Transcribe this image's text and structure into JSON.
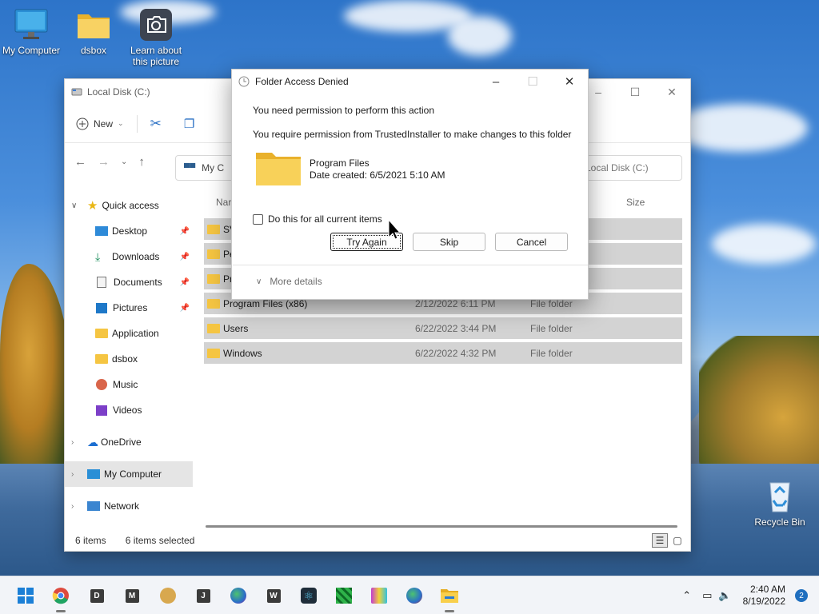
{
  "desktop": {
    "icons": [
      {
        "label": "My Computer"
      },
      {
        "label": "dsbox"
      },
      {
        "label": "Learn about this picture"
      },
      {
        "label": "Recycle Bin"
      }
    ]
  },
  "explorer": {
    "title": "Local Disk (C:)",
    "command_bar": {
      "new_label": "New"
    },
    "address": {
      "path_visible": "My C",
      "search_placeholder": "Local Disk (C:)"
    },
    "nav": {
      "quick_access": "Quick access",
      "items": [
        {
          "label": "Desktop",
          "pinned": true
        },
        {
          "label": "Downloads",
          "pinned": true
        },
        {
          "label": "Documents",
          "pinned": true
        },
        {
          "label": "Pictures",
          "pinned": true
        },
        {
          "label": "Application",
          "pinned": false
        },
        {
          "label": "dsbox",
          "pinned": false
        },
        {
          "label": "Music",
          "pinned": false
        },
        {
          "label": "Videos",
          "pinned": false
        }
      ],
      "onedrive": "OneDrive",
      "my_computer": "My Computer",
      "network": "Network"
    },
    "columns": {
      "name": "Nar",
      "size": "Size"
    },
    "files": [
      {
        "name": "SV",
        "date": "",
        "type": ""
      },
      {
        "name": "Pe",
        "date": "",
        "type": ""
      },
      {
        "name": "Pr",
        "date": "",
        "type": ""
      },
      {
        "name": "Program Files (x86)",
        "date": "2/12/2022 6:11 PM",
        "type": "File folder"
      },
      {
        "name": "Users",
        "date": "6/22/2022 3:44 PM",
        "type": "File folder"
      },
      {
        "name": "Windows",
        "date": "6/22/2022 4:32 PM",
        "type": "File folder"
      }
    ],
    "status": {
      "items": "6 items",
      "selected": "6 items selected"
    }
  },
  "dialog": {
    "title": "Folder Access Denied",
    "message1": "You need permission to perform this action",
    "message2": "You require permission from TrustedInstaller to make changes to this folder",
    "folder_name": "Program Files",
    "folder_date": "Date created: 6/5/2021 5:10 AM",
    "checkbox_label": "Do this for all current items",
    "checkbox_checked": false,
    "buttons": {
      "try_again": "Try Again",
      "skip": "Skip",
      "cancel": "Cancel"
    },
    "more_details": "More details"
  },
  "taskbar": {
    "apps": [
      {
        "icon": "windows-start-icon"
      },
      {
        "icon": "chrome-icon"
      },
      {
        "letter": "D"
      },
      {
        "letter": "M"
      },
      {
        "icon": "doge-icon"
      },
      {
        "letter": "J"
      },
      {
        "icon": "globe-app-icon"
      },
      {
        "letter": "W"
      },
      {
        "icon": "atom-icon"
      },
      {
        "icon": "green-grid-icon"
      },
      {
        "icon": "film-icon"
      },
      {
        "icon": "globe-app-2-icon"
      },
      {
        "icon": "file-explorer-icon"
      }
    ],
    "time": "2:40 AM",
    "date": "8/19/2022",
    "notification_count": "2"
  }
}
